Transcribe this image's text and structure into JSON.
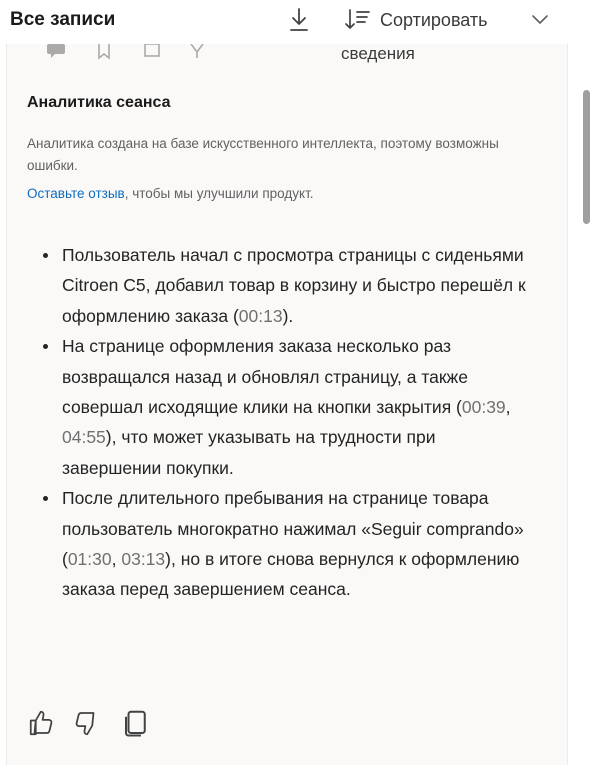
{
  "header": {
    "title": "Все записи",
    "sort_label": "Сортировать"
  },
  "card": {
    "cut_off_label": "сведения",
    "insights": {
      "title": "Аналитика сеанса",
      "disclaimer": "Аналитика создана на базе искусственного интеллекта, поэтому возможны ошибки.",
      "feedback_link": "Оставьте отзыв",
      "feedback_rest": ", чтобы мы улучшили продукт."
    },
    "summary": [
      {
        "parts": [
          "Пользователь начал с просмотра страницы с сиденьями Citroen C5, добавил товар в корзину и быстро перешёл к оформлению заказа (",
          "00:13",
          ")."
        ]
      },
      {
        "parts": [
          "На странице оформления заказа несколько раз возвращался назад и обновлял страницу, а также совершал исходящие клики на кнопки закрытия (",
          "00:39",
          ", ",
          "04:55",
          "), что может указывать на трудности при завершении покупки."
        ]
      },
      {
        "parts": [
          "После длительного пребывания на странице товара пользователь многократно нажимал «Seguir comprando» (",
          "01:30",
          ", ",
          "03:13",
          "), но в итоге снова вернулся к оформлению заказа перед завершением сеанса."
        ]
      }
    ],
    "actions": {
      "like_icon": "thumbs-up-icon",
      "dislike_icon": "thumbs-down-icon",
      "copy_icon": "copy-icon"
    }
  },
  "colors": {
    "link": "#0f6cbd",
    "timestamp": "#707070",
    "card_background": "#faf9f8",
    "scroll_thumb": "#a19f9d"
  }
}
